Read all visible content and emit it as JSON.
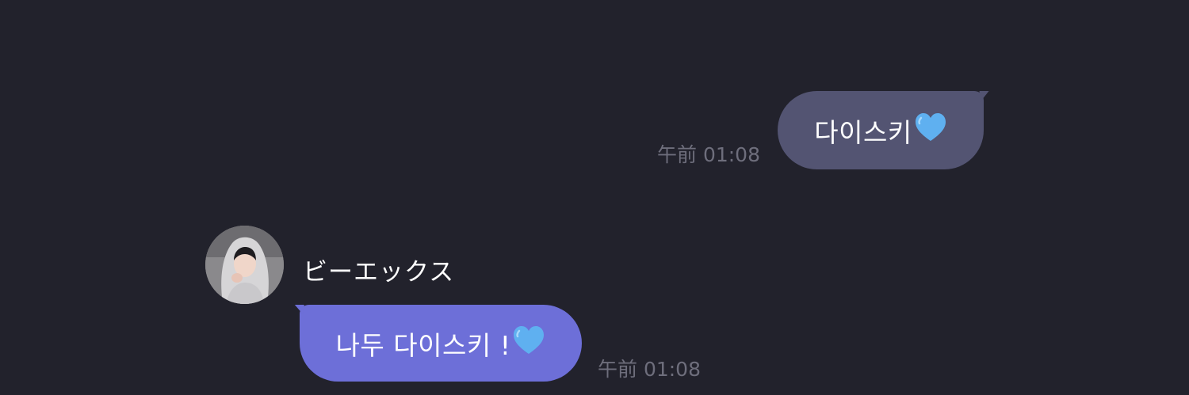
{
  "conversation": {
    "outgoing": {
      "text": "다이스키",
      "emoji": "blue-heart-icon",
      "time": "午前 01:08",
      "bubble_color": "#535472"
    },
    "incoming": {
      "sender": "ビーエックス",
      "text": "나두 다이스키 !",
      "emoji": "blue-heart-icon",
      "time": "午前 01:08",
      "bubble_color": "#6d6fd8"
    }
  },
  "colors": {
    "background": "#22222c",
    "timestamp": "#6e6e7c",
    "heart": "#5fb0f0"
  }
}
